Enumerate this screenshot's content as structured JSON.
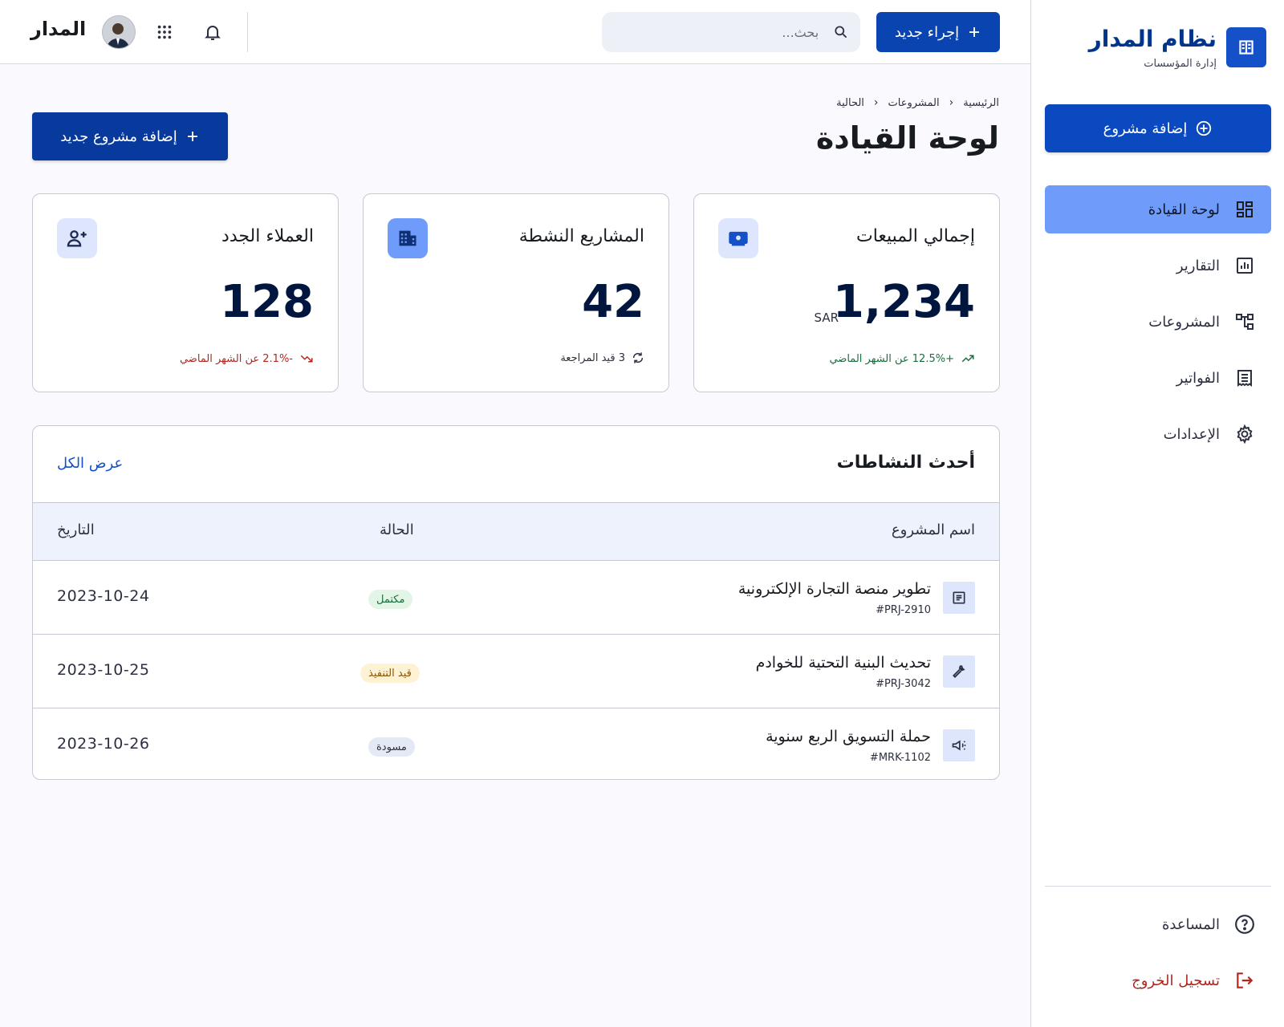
{
  "sidebar": {
    "brand_title": "نظام المدار",
    "brand_subtitle": "إدارة المؤسسات",
    "add_project_label": "إضافة مشروع",
    "items": [
      {
        "label": "لوحة القيادة",
        "icon": "dashboard-icon",
        "active": true
      },
      {
        "label": "التقارير",
        "icon": "reports-icon",
        "active": false
      },
      {
        "label": "المشروعات",
        "icon": "projects-icon",
        "active": false
      },
      {
        "label": "الفواتير",
        "icon": "invoices-icon",
        "active": false
      },
      {
        "label": "الإعدادات",
        "icon": "settings-icon",
        "active": false
      }
    ],
    "help_label": "المساعدة",
    "logout_label": "تسجيل الخروج"
  },
  "topbar": {
    "new_action_label": "إجراء جديد",
    "search_placeholder": "بحث...",
    "brand": "المدار"
  },
  "breadcrumb": [
    "الرئيسية",
    "المشروعات",
    "الحالية"
  ],
  "page_title": "لوحة القيادة",
  "add_new_project_label": "إضافة مشروع جديد",
  "stats": {
    "sales": {
      "title": "إجمالي المبيعات",
      "value": "1,234",
      "unit": "SAR",
      "trend": "+12.5% عن الشهر الماضي",
      "icon": "payments-icon"
    },
    "projects": {
      "title": "المشاريع النشطة",
      "value": "42",
      "trend": "3 قيد المراجعة",
      "icon": "building-icon"
    },
    "clients": {
      "title": "العملاء الجدد",
      "value": "128",
      "trend": "-2.1% عن الشهر الماضي",
      "icon": "person-add-icon"
    }
  },
  "activity": {
    "title": "أحدث النشاطات",
    "view_all": "عرض الكل",
    "columns": {
      "name": "اسم المشروع",
      "status": "الحالة",
      "date": "التاريخ"
    },
    "rows": [
      {
        "name": "تطوير منصة التجارة الإلكترونية",
        "id": "#PRJ-2910",
        "status": "مكتمل",
        "date": "2023-10-24",
        "icon": "article-icon"
      },
      {
        "name": "تحديث البنية التحتية للخوادم",
        "id": "#PRJ-3042",
        "status": "قيد التنفيذ",
        "date": "2023-10-25",
        "icon": "wrench-icon"
      },
      {
        "name": "حملة التسويق الربع سنوية",
        "id": "#MRK-1102",
        "status": "مسودة",
        "date": "2023-10-26",
        "icon": "megaphone-icon"
      }
    ]
  },
  "colors": {
    "primary": "#0a49c0",
    "active_nav": "#6f9cfa",
    "success": "#1a6e3d",
    "danger": "#b3261e"
  }
}
